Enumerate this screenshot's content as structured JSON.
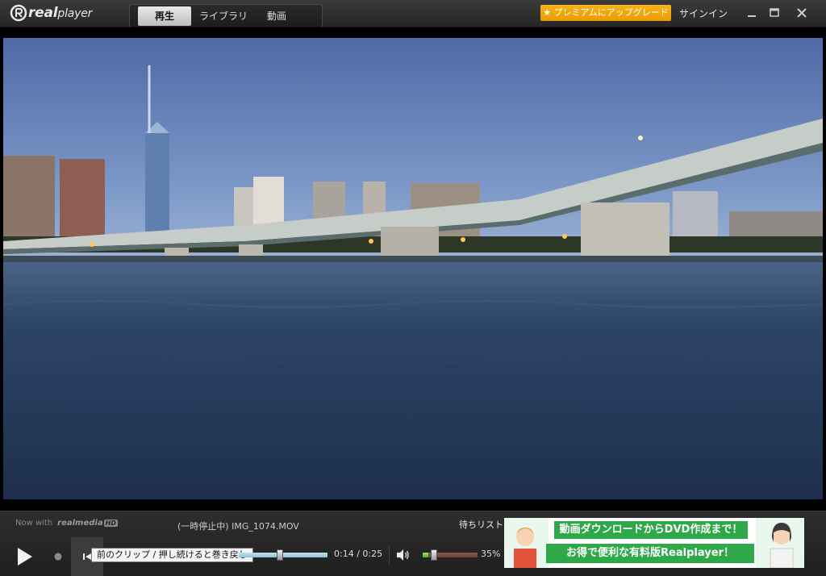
{
  "app": {
    "logo_bold": "real",
    "logo_text": "player"
  },
  "tabs": [
    {
      "label": "再生",
      "active": true
    },
    {
      "label": "ライブラリ",
      "active": false
    },
    {
      "label": "動画",
      "active": false
    }
  ],
  "header": {
    "upgrade_label": "★ プレミアムにアップグレード",
    "signin_label": "サインイン"
  },
  "player": {
    "now_with": "Now with",
    "brand": "realmedia",
    "brand_badge": "HD",
    "status": "(一時停止中) IMG_1074.MOV",
    "queue_label": "待ちリスト",
    "tooltip": "前のクリップ / 押し続けると巻き戻し",
    "time_current": "0:14",
    "time_total": "0:25",
    "time_display": "0:14 / 0:25",
    "progress_fraction": 0.56,
    "volume_percent": 35,
    "volume_label": "35%"
  },
  "ad": {
    "line1": "動画ダウンロードからDVD作成まで！",
    "line2": "お得で便利な有料版Realplayer！"
  },
  "colors": {
    "accent_upgrade": "#f5a50e",
    "ad_green": "#2fa84a",
    "seek_blue": "#9fd0e4",
    "volume_green": "#5fc43a"
  },
  "icons": [
    "realplayer-logo-icon",
    "minimize-icon",
    "maximize-icon",
    "close-icon",
    "play-icon",
    "stop-icon",
    "previous-clip-icon",
    "volume-icon"
  ]
}
